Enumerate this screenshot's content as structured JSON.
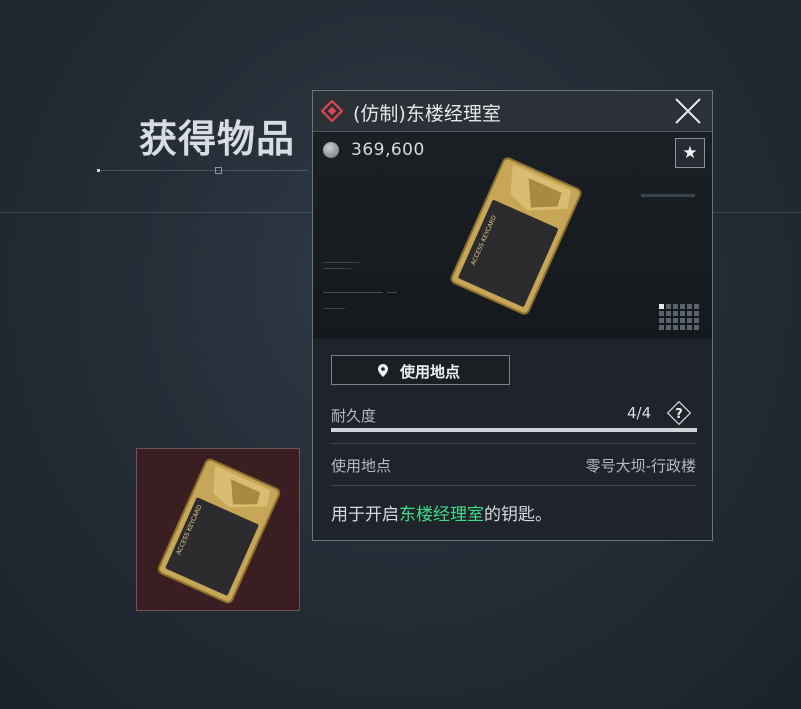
{
  "screen_title": "获得物品",
  "item": {
    "name": "(仿制)东楼经理室",
    "price": "369,600",
    "rarity_color": "#e0464f",
    "card_text": "ACCESS KEYCARD"
  },
  "actions": {
    "location_button": "使用地点",
    "favorite_icon": "star-icon",
    "close_icon": "close-icon"
  },
  "durability": {
    "label": "耐久度",
    "value": "4/4",
    "fraction": 1.0,
    "help_glyph": "?"
  },
  "details": {
    "location_label": "使用地点",
    "location_value": "零号大坝-行政楼"
  },
  "description": {
    "prefix": "用于开启",
    "highlight": "东楼经理室",
    "suffix": "的钥匙。",
    "highlight_color": "#3ddc8a"
  }
}
